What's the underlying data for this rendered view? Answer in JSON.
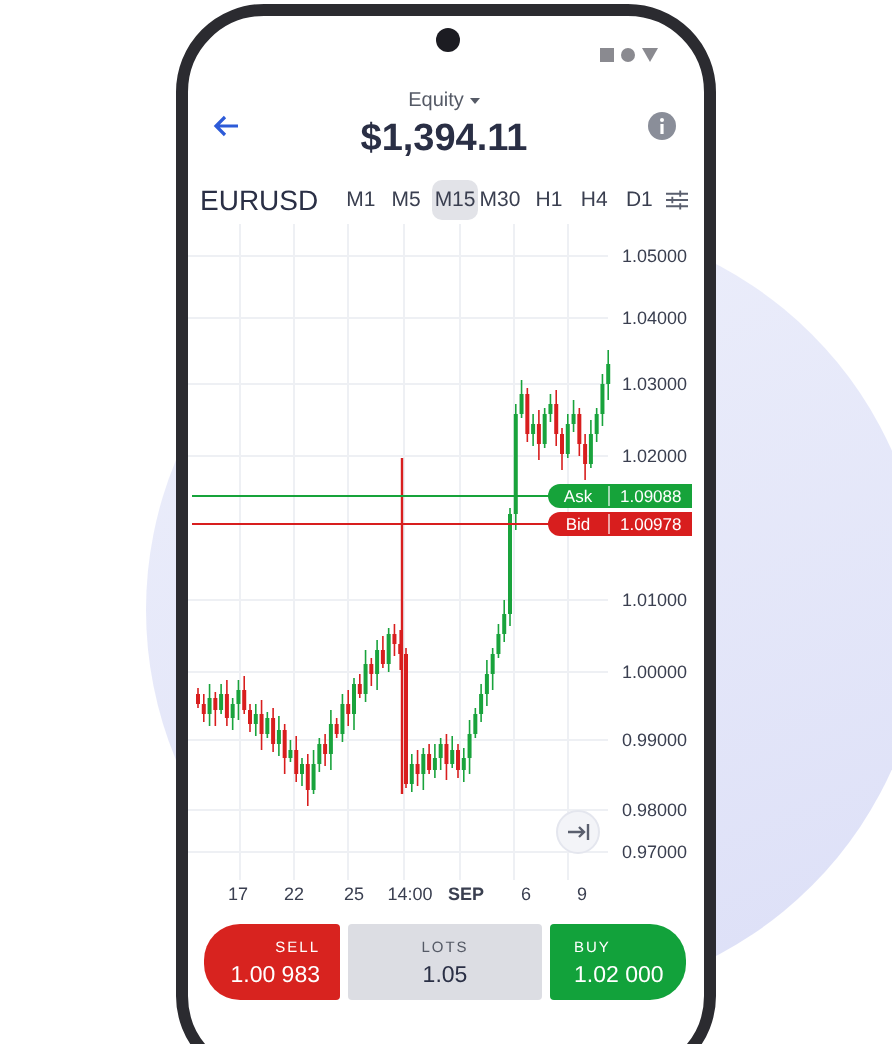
{
  "header": {
    "title": "Equity",
    "value": "$1,394.11"
  },
  "symbol": "EURUSD",
  "timeframes": [
    {
      "label": "M1",
      "selected": false
    },
    {
      "label": "M5",
      "selected": false
    },
    {
      "label": "M15",
      "selected": true
    },
    {
      "label": "M30",
      "selected": false
    },
    {
      "label": "H1",
      "selected": false
    },
    {
      "label": "H4",
      "selected": false
    },
    {
      "label": "D1",
      "selected": false
    }
  ],
  "chart": {
    "y_labels": [
      "1.05000",
      "1.04000",
      "1.03000",
      "1.02000",
      "1.01000",
      "1.00000",
      "0.99000",
      "0.98000",
      "0.97000"
    ],
    "x_labels": [
      {
        "label": "17",
        "kind": "day"
      },
      {
        "label": "22",
        "kind": "day"
      },
      {
        "label": "25",
        "kind": "day"
      },
      {
        "label": "14:00",
        "kind": "day"
      },
      {
        "label": "SEP",
        "kind": "month"
      },
      {
        "label": "6",
        "kind": "day"
      },
      {
        "label": "9",
        "kind": "day"
      }
    ],
    "ask": {
      "label": "Ask",
      "price": "1.09088"
    },
    "bid": {
      "label": "Bid",
      "price": "1.00978"
    }
  },
  "order_panel": {
    "sell": {
      "label": "SELL",
      "price": "1.00 983"
    },
    "lots": {
      "label": "LOTS",
      "value": "1.05"
    },
    "buy": {
      "label": "BUY",
      "price": "1.02 000"
    }
  }
}
